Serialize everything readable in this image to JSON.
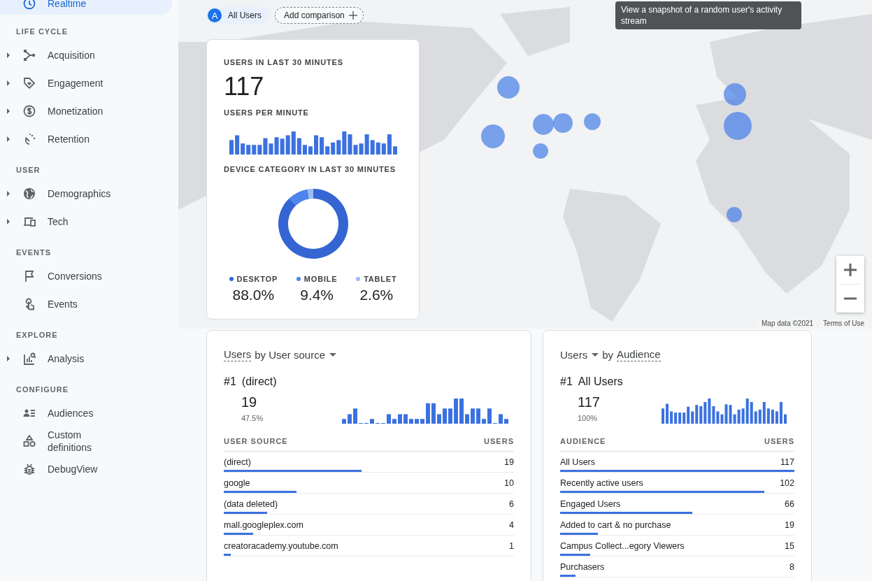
{
  "sidebar": {
    "sections": [
      {
        "items": [
          {
            "label": "Realtime",
            "selected": true,
            "expandable": false
          }
        ]
      },
      {
        "header": "LIFE CYCLE",
        "items": [
          {
            "label": "Acquisition",
            "selected": false,
            "expandable": true
          },
          {
            "label": "Engagement",
            "selected": false,
            "expandable": true
          },
          {
            "label": "Monetization",
            "selected": false,
            "expandable": true
          },
          {
            "label": "Retention",
            "selected": false,
            "expandable": true
          }
        ]
      },
      {
        "header": "USER",
        "items": [
          {
            "label": "Demographics",
            "selected": false,
            "expandable": true
          },
          {
            "label": "Tech",
            "selected": false,
            "expandable": true
          }
        ]
      },
      {
        "header": "EVENTS",
        "items": [
          {
            "label": "Conversions",
            "selected": false,
            "expandable": false
          },
          {
            "label": "Events",
            "selected": false,
            "expandable": false
          }
        ]
      },
      {
        "header": "EXPLORE",
        "items": [
          {
            "label": "Analysis",
            "selected": false,
            "expandable": true
          }
        ]
      },
      {
        "header": "CONFIGURE",
        "items": [
          {
            "label": "Audiences",
            "selected": false,
            "expandable": false
          },
          {
            "label": "Custom definitions",
            "selected": false,
            "expandable": false
          },
          {
            "label": "DebugView",
            "selected": false,
            "expandable": false
          }
        ]
      }
    ]
  },
  "comparison": {
    "chips": [
      {
        "kind": "segment",
        "badge": "A",
        "label": "All Users"
      },
      {
        "kind": "add",
        "label": "Add comparison"
      }
    ]
  },
  "tooltip": {
    "text": "View a snapshot of a random user's activity stream"
  },
  "summary_card": {
    "users_label": "USERS IN LAST 30 MINUTES",
    "users_value": "117",
    "per_minute_label": "USERS PER MINUTE",
    "device_label": "DEVICE CATEGORY IN LAST 30 MINUTES",
    "device_chart": {
      "chart_data": {
        "type": "donut",
        "categories": [
          "DESKTOP",
          "MOBILE",
          "TABLET"
        ],
        "series": [
          {
            "values": [
              88.0,
              9.4,
              2.6
            ]
          }
        ]
      }
    },
    "legend": [
      {
        "value": "88.0%",
        "color": "#3465d3"
      },
      {
        "value": "9.4%",
        "color": "#4d85ec"
      },
      {
        "value": "2.6%",
        "color": "#9cbcf5"
      }
    ]
  },
  "map_footer": {
    "attribution": "Map data ©2021",
    "terms": "Terms of Use"
  },
  "cards": [
    {
      "title_parts": [
        {
          "text": "Users",
          "underline": true,
          "dropdown": false
        },
        {
          "text": "by User source",
          "underline": false,
          "dropdown": true
        }
      ],
      "rank": "#1",
      "top_name": "(direct)",
      "top_value": "19",
      "top_share": "47.5%",
      "columns": [
        "USER SOURCE",
        "USERS"
      ],
      "rows": [
        {
          "name": "(direct)",
          "value": "19",
          "level": 0.475
        },
        {
          "name": "google",
          "value": "10",
          "level": 0.25
        },
        {
          "name": "(data deleted)",
          "value": "6",
          "level": 0.15
        },
        {
          "name": "mall.googleplex.com",
          "value": "4",
          "level": 0.1
        },
        {
          "name": "creatoracademy.youtube.com",
          "value": "1",
          "level": 0.025
        }
      ]
    },
    {
      "title_parts": [
        {
          "text": "Users",
          "underline": false,
          "dropdown": true
        },
        {
          "text": "by",
          "underline": false,
          "dropdown": false
        },
        {
          "text": "Audience",
          "underline": true,
          "dropdown": false
        }
      ],
      "rank": "#1",
      "top_name": "All Users",
      "top_value": "117",
      "top_share": "100%",
      "columns": [
        "AUDIENCE",
        "USERS"
      ],
      "rows": [
        {
          "name": "All Users",
          "value": "117",
          "level": 1.0
        },
        {
          "name": "Recently active users",
          "value": "102",
          "level": 0.872
        },
        {
          "name": "Engaged Users",
          "value": "66",
          "level": 0.564
        },
        {
          "name": "Added to cart & no purchase",
          "value": "19",
          "level": 0.162
        },
        {
          "name": "Campus Collect...egory Viewers",
          "value": "15",
          "level": 0.127
        },
        {
          "name": "Purchasers",
          "value": "8",
          "level": 0.067
        }
      ]
    }
  ]
}
